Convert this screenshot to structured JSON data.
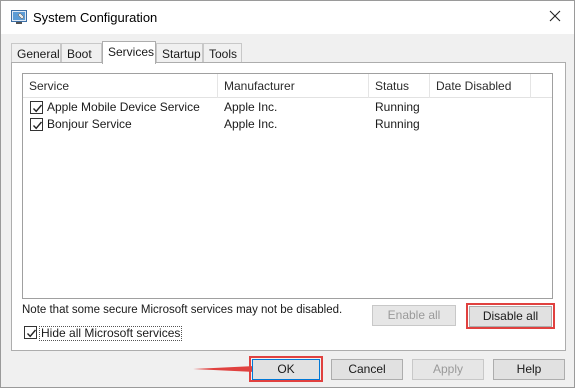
{
  "window": {
    "title": "System Configuration",
    "app_icon": "msconfig-icon",
    "close_icon": "close-icon"
  },
  "tabs": [
    {
      "label": "General",
      "active": false
    },
    {
      "label": "Boot",
      "active": false
    },
    {
      "label": "Services",
      "active": true
    },
    {
      "label": "Startup",
      "active": false
    },
    {
      "label": "Tools",
      "active": false
    }
  ],
  "services": {
    "columns": [
      "Service",
      "Manufacturer",
      "Status",
      "Date Disabled"
    ],
    "rows": [
      {
        "checked": true,
        "service": "Apple Mobile Device Service",
        "manufacturer": "Apple Inc.",
        "status": "Running",
        "date_disabled": ""
      },
      {
        "checked": true,
        "service": "Bonjour Service",
        "manufacturer": "Apple Inc.",
        "status": "Running",
        "date_disabled": ""
      }
    ]
  },
  "note": "Note that some secure Microsoft services may not be disabled.",
  "enable_all_label": "Enable all",
  "disable_all_label": "Disable all",
  "hide_microsoft": {
    "label": "Hide all Microsoft services",
    "checked": true
  },
  "footer": {
    "ok_label": "OK",
    "cancel_label": "Cancel",
    "apply_label": "Apply",
    "help_label": "Help"
  },
  "colors": {
    "highlight": "#e0413f",
    "default_button_border": "#0078d7"
  }
}
